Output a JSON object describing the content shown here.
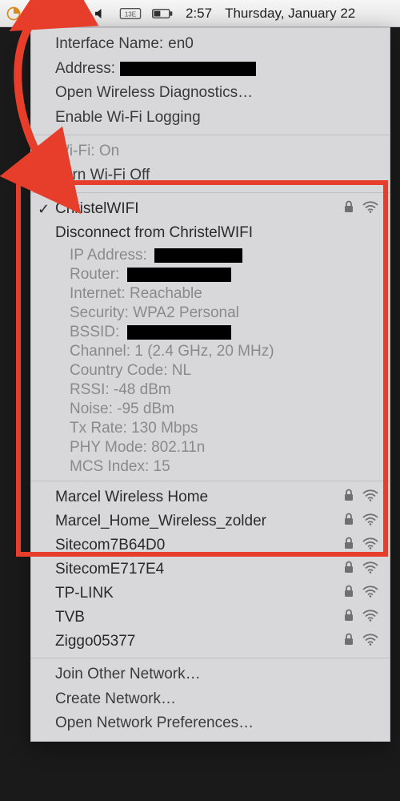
{
  "menubar": {
    "clock": "2:57",
    "date": "Thursday, January 22"
  },
  "header": {
    "interface_label": "Interface Name:",
    "interface_value": "en0",
    "address_label": "Address:",
    "diag": "Open Wireless Diagnostics…",
    "logging": "Enable Wi-Fi Logging"
  },
  "wifi": {
    "status_label": "Wi-Fi: On",
    "turn_off": "Turn Wi-Fi Off"
  },
  "connected": {
    "name": "ChristelWIFI",
    "disconnect": "Disconnect from ChristelWIFI",
    "ip_label": "IP Address:",
    "router_label": "Router:",
    "internet_label": "Internet:",
    "internet_value": "Reachable",
    "security_label": "Security:",
    "security_value": "WPA2 Personal",
    "bssid_label": "BSSID:",
    "channel_label": "Channel:",
    "channel_value": "1 (2.4 GHz, 20 MHz)",
    "country_label": "Country Code:",
    "country_value": "NL",
    "rssi_label": "RSSI:",
    "rssi_value": "-48 dBm",
    "noise_label": "Noise:",
    "noise_value": "-95 dBm",
    "txrate_label": "Tx Rate:",
    "txrate_value": "130 Mbps",
    "phy_label": "PHY Mode:",
    "phy_value": "802.11n",
    "mcs_label": "MCS Index:",
    "mcs_value": "15"
  },
  "networks": [
    {
      "name": "Marcel Wireless Home"
    },
    {
      "name": "Marcel_Home_Wireless_zolder"
    },
    {
      "name": "Sitecom7B64D0"
    },
    {
      "name": "SitecomE717E4"
    },
    {
      "name": "TP-LINK"
    },
    {
      "name": "TVB"
    },
    {
      "name": "Ziggo05377"
    }
  ],
  "footer": {
    "join": "Join Other Network…",
    "create": "Create Network…",
    "prefs": "Open Network Preferences…"
  }
}
